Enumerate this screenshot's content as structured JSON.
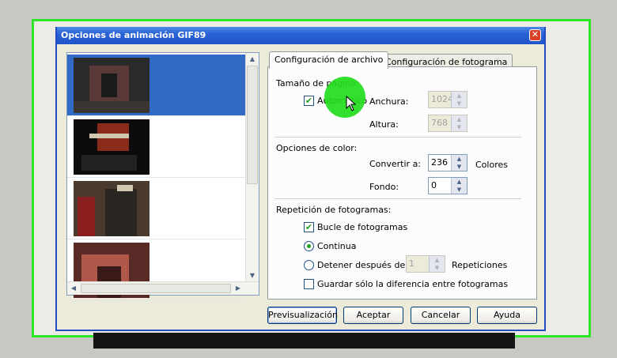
{
  "dialog": {
    "title": "Opciones de animación GIF89",
    "close_label": "✕"
  },
  "tabs": [
    {
      "label": "Configuración de archivo",
      "active": true
    },
    {
      "label": "Configuración de fotograma",
      "active": false
    }
  ],
  "page_size": {
    "heading": "Tamaño de página:",
    "auto_label": "Automático",
    "auto_checked": true,
    "width_label": "Anchura:",
    "width_value": "1024",
    "height_label": "Altura:",
    "height_value": "768"
  },
  "color": {
    "heading": "Opciones de color:",
    "convert_label": "Convertir a:",
    "convert_value": "236",
    "colors_label": "Colores",
    "background_label": "Fondo:",
    "background_value": "0"
  },
  "repeat": {
    "heading": "Repetición de fotogramas:",
    "loop_label": "Bucle de fotogramas",
    "loop_checked": true,
    "continuous_label": "Continua",
    "continuous_selected": true,
    "stop_label": "Detener después de",
    "stop_value": "1",
    "repetitions_label": "Repeticiones",
    "diff_label": "Guardar sólo la diferencia entre fotogramas",
    "diff_checked": false
  },
  "buttons": {
    "preview": "Previsualización",
    "accept": "Aceptar",
    "cancel": "Cancelar",
    "help": "Ayuda"
  },
  "thumbnails": [
    {
      "name": "frame-1",
      "selected": true,
      "colors": [
        "#2a2a2a",
        "#5a3a38",
        "#1a1a1a"
      ]
    },
    {
      "name": "frame-2",
      "selected": false,
      "colors": [
        "#141414",
        "#8a2a1a",
        "#0c0c0c"
      ]
    },
    {
      "name": "frame-3",
      "selected": false,
      "colors": [
        "#4a3a2e",
        "#8b1f1f",
        "#2a2622"
      ]
    },
    {
      "name": "frame-4",
      "selected": false,
      "colors": [
        "#5a2a26",
        "#b0584a",
        "#3a1a18"
      ]
    }
  ],
  "accent_colors": {
    "highlight": "#316ac5",
    "titlebar": "#2a62d4",
    "cursor_halo": "#22dd1c"
  }
}
